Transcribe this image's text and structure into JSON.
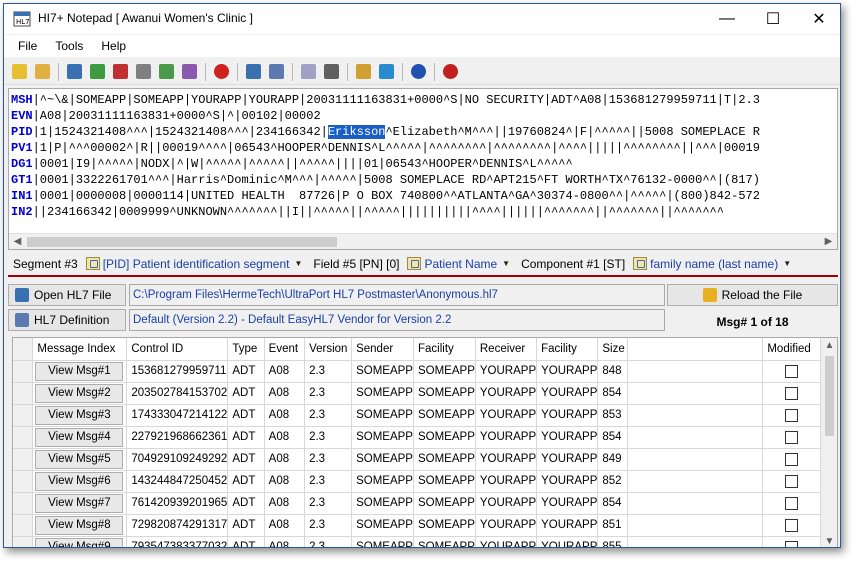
{
  "window": {
    "title": "HI7+ Notepad [ Awanui Women's Clinic ]"
  },
  "controls": {
    "minimize": "—",
    "maximize": "☐",
    "close": "✕"
  },
  "menu": [
    "File",
    "Tools",
    "Help"
  ],
  "toolbar": {
    "groups": [
      [
        {
          "name": "new-icon",
          "color": "#e6c030"
        },
        {
          "name": "open-icon",
          "color": "#e0b040"
        }
      ],
      [
        {
          "name": "save-icon",
          "color": "#3a6fb0"
        },
        {
          "name": "import-icon",
          "color": "#3e9a3e"
        },
        {
          "name": "export-icon",
          "color": "#c03030"
        },
        {
          "name": "find-icon",
          "color": "#808080"
        },
        {
          "name": "settings-icon",
          "color": "#4a9a4a"
        },
        {
          "name": "tools-icon",
          "color": "#8a5ab0"
        }
      ],
      [
        {
          "name": "delete-icon",
          "color": "#d02020"
        }
      ],
      [
        {
          "name": "view-icon",
          "color": "#3a6fb0"
        },
        {
          "name": "edit-icon",
          "color": "#5a7ab0"
        }
      ],
      [
        {
          "name": "copy-icon",
          "color": "#a0a0c8"
        },
        {
          "name": "print-icon",
          "color": "#606060"
        }
      ],
      [
        {
          "name": "plugin-icon",
          "color": "#d0a030"
        },
        {
          "name": "connect-icon",
          "color": "#2a8ad0"
        }
      ],
      [
        {
          "name": "help-icon",
          "color": "#2050b0"
        }
      ],
      [
        {
          "name": "power-icon",
          "color": "#c02020"
        }
      ]
    ]
  },
  "hl7": {
    "lines": [
      {
        "seg": "MSH",
        "text": "|^~\\&|SOMEAPP|SOMEAPP|YOURAPP|YOURAPP|20031111163831+0000^S|NO SECURITY|ADT^A08|153681279959711|T|2.3"
      },
      {
        "seg": "EVN",
        "text": "|A08|20031111163831+0000^S|^|00102|00002"
      },
      {
        "seg": "PID",
        "pre": "|1|1524321408^^^|1524321408^^^|234166342|",
        "hl": "Eriksson",
        "text": "^Elizabeth^M^^^||19760824^|F|^^^^^||5008 SOMEPLACE R"
      },
      {
        "seg": "PV1",
        "text": "|1|P|^^^00002^|R||00019^^^^|06543^HOOPER^DENNIS^L^^^^^|^^^^^^^^|^^^^^^^^|^^^^|||||^^^^^^^^||^^^|00019"
      },
      {
        "seg": "DG1",
        "text": "|0001|I9|^^^^^|NODX|^|W|^^^^^|^^^^^||^^^^^||||01|06543^HOOPER^DENNIS^L^^^^^"
      },
      {
        "seg": "GT1",
        "text": "|0001|3322261701^^^|Harris^Dominic^M^^^|^^^^^|5008 SOMEPLACE RD^APT215^FT WORTH^TX^76132-0000^^|(817)"
      },
      {
        "seg": "IN1",
        "text": "|0001|0000008|0000114|UNITED HEALTH  87726|P O BOX 740800^^ATLANTA^GA^30374-0800^^|^^^^^|(800)842-572"
      },
      {
        "seg": "IN2",
        "text": "||234166342|0009999^UNKNOWN^^^^^^^||I||^^^^^||^^^^^||||||||||^^^^||||||^^^^^^^||^^^^^^^||^^^^^^^"
      }
    ]
  },
  "segment_bar": {
    "segment_label": "Segment #3",
    "segment_value": "[PID] Patient identification segment",
    "field_label": "Field #5 [PN] [0]",
    "field_value": "Patient Name",
    "component_label": "Component #1 [ST]",
    "component_value": "family name (last name)"
  },
  "file": {
    "open_label": "Open HL7 File",
    "path": "C:\\Program Files\\HermeTech\\UltraPort HL7 Postmaster\\Anonymous.hl7",
    "reload_label": "Reload the File",
    "definition_label": "HL7 Definition",
    "definition": "Default (Version 2.2) - Default EasyHL7 Vendor for Version 2.2",
    "msg_counter": "Msg# 1 of 18"
  },
  "grid": {
    "columns": [
      "Message Index",
      "Control ID",
      "Type",
      "Event",
      "Version",
      "Sender",
      "Facility",
      "Receiver",
      "Facility",
      "Size",
      "",
      "Modified"
    ],
    "rows": [
      {
        "button": "View Msg#1",
        "control_id": "153681279959711",
        "type": "ADT",
        "event": "A08",
        "version": "2.3",
        "sender": "SOMEAPP",
        "facility": "SOMEAPP",
        "receiver": "YOURAPP",
        "rfacility": "YOURAPP",
        "size": "848"
      },
      {
        "button": "View Msg#2",
        "control_id": "203502784153702",
        "type": "ADT",
        "event": "A08",
        "version": "2.3",
        "sender": "SOMEAPP",
        "facility": "SOMEAPP",
        "receiver": "YOURAPP",
        "rfacility": "YOURAPP",
        "size": "854"
      },
      {
        "button": "View Msg#3",
        "control_id": "174333047214122",
        "type": "ADT",
        "event": "A08",
        "version": "2.3",
        "sender": "SOMEAPP",
        "facility": "SOMEAPP",
        "receiver": "YOURAPP",
        "rfacility": "YOURAPP",
        "size": "853"
      },
      {
        "button": "View Msg#4",
        "control_id": "227921968662361",
        "type": "ADT",
        "event": "A08",
        "version": "2.3",
        "sender": "SOMEAPP",
        "facility": "SOMEAPP",
        "receiver": "YOURAPP",
        "rfacility": "YOURAPP",
        "size": "854"
      },
      {
        "button": "View Msg#5",
        "control_id": "704929109249292",
        "type": "ADT",
        "event": "A08",
        "version": "2.3",
        "sender": "SOMEAPP",
        "facility": "SOMEAPP",
        "receiver": "YOURAPP",
        "rfacility": "YOURAPP",
        "size": "849"
      },
      {
        "button": "View Msg#6",
        "control_id": "143244847250452",
        "type": "ADT",
        "event": "A08",
        "version": "2.3",
        "sender": "SOMEAPP",
        "facility": "SOMEAPP",
        "receiver": "YOURAPP",
        "rfacility": "YOURAPP",
        "size": "852"
      },
      {
        "button": "View Msg#7",
        "control_id": "761420939201965",
        "type": "ADT",
        "event": "A08",
        "version": "2.3",
        "sender": "SOMEAPP",
        "facility": "SOMEAPP",
        "receiver": "YOURAPP",
        "rfacility": "YOURAPP",
        "size": "854"
      },
      {
        "button": "View Msg#8",
        "control_id": "729820874291317",
        "type": "ADT",
        "event": "A08",
        "version": "2.3",
        "sender": "SOMEAPP",
        "facility": "SOMEAPP",
        "receiver": "YOURAPP",
        "rfacility": "YOURAPP",
        "size": "851"
      },
      {
        "button": "View Msg#9",
        "control_id": "793547383377032",
        "type": "ADT",
        "event": "A08",
        "version": "2.3",
        "sender": "SOMEAPP",
        "facility": "SOMEAPP",
        "receiver": "YOURAPP",
        "rfacility": "YOURAPP",
        "size": "855"
      }
    ]
  },
  "colors": {
    "segment_name": "#0000d0",
    "link": "#1a3fa8",
    "selection": "#1a5fc4",
    "segment_bar_underline": "#a00000"
  }
}
